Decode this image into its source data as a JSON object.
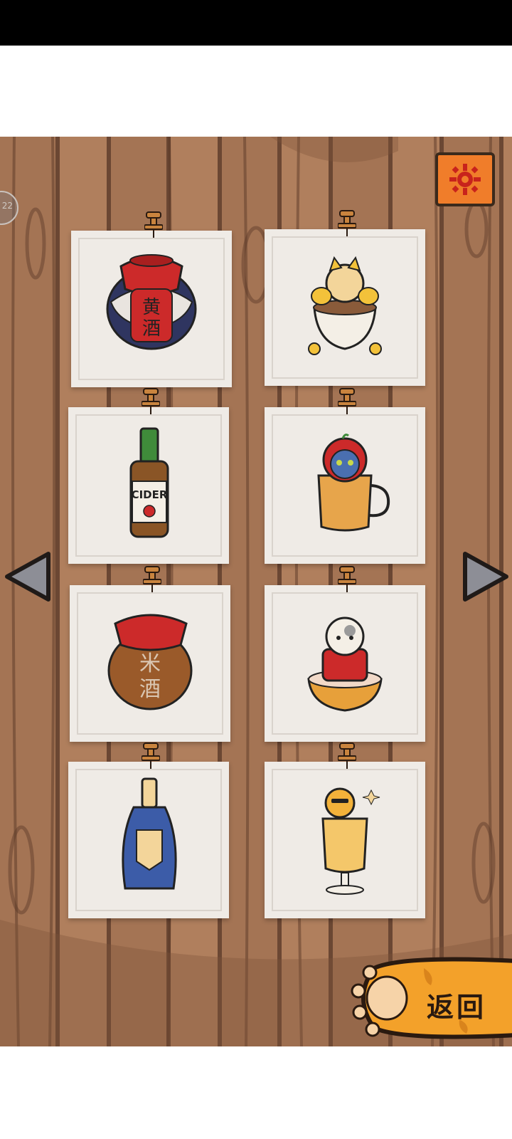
{
  "status_bar": {
    "background": "#000000"
  },
  "ghost_marker": {
    "label": "22"
  },
  "settings": {
    "icon": "gear-icon",
    "color": "#f07d2a"
  },
  "navigation": {
    "prev_icon": "triangle-left-icon",
    "next_icon": "triangle-right-icon"
  },
  "cards": [
    {
      "name": "yellow-wine-jar",
      "jar_text_1": "黄",
      "jar_text_2": "酒"
    },
    {
      "name": "golden-cat-in-cup"
    },
    {
      "name": "cider-bottle",
      "label": "CIDER"
    },
    {
      "name": "blue-cat-apple-mug"
    },
    {
      "name": "rice-wine-jar",
      "jar_text_1": "米",
      "jar_text_2": "酒"
    },
    {
      "name": "lucky-cat-bowl"
    },
    {
      "name": "blue-label-bottle"
    },
    {
      "name": "cat-sundae-glass"
    }
  ],
  "back_button": {
    "label": "返回",
    "color": "#f3a12a"
  }
}
